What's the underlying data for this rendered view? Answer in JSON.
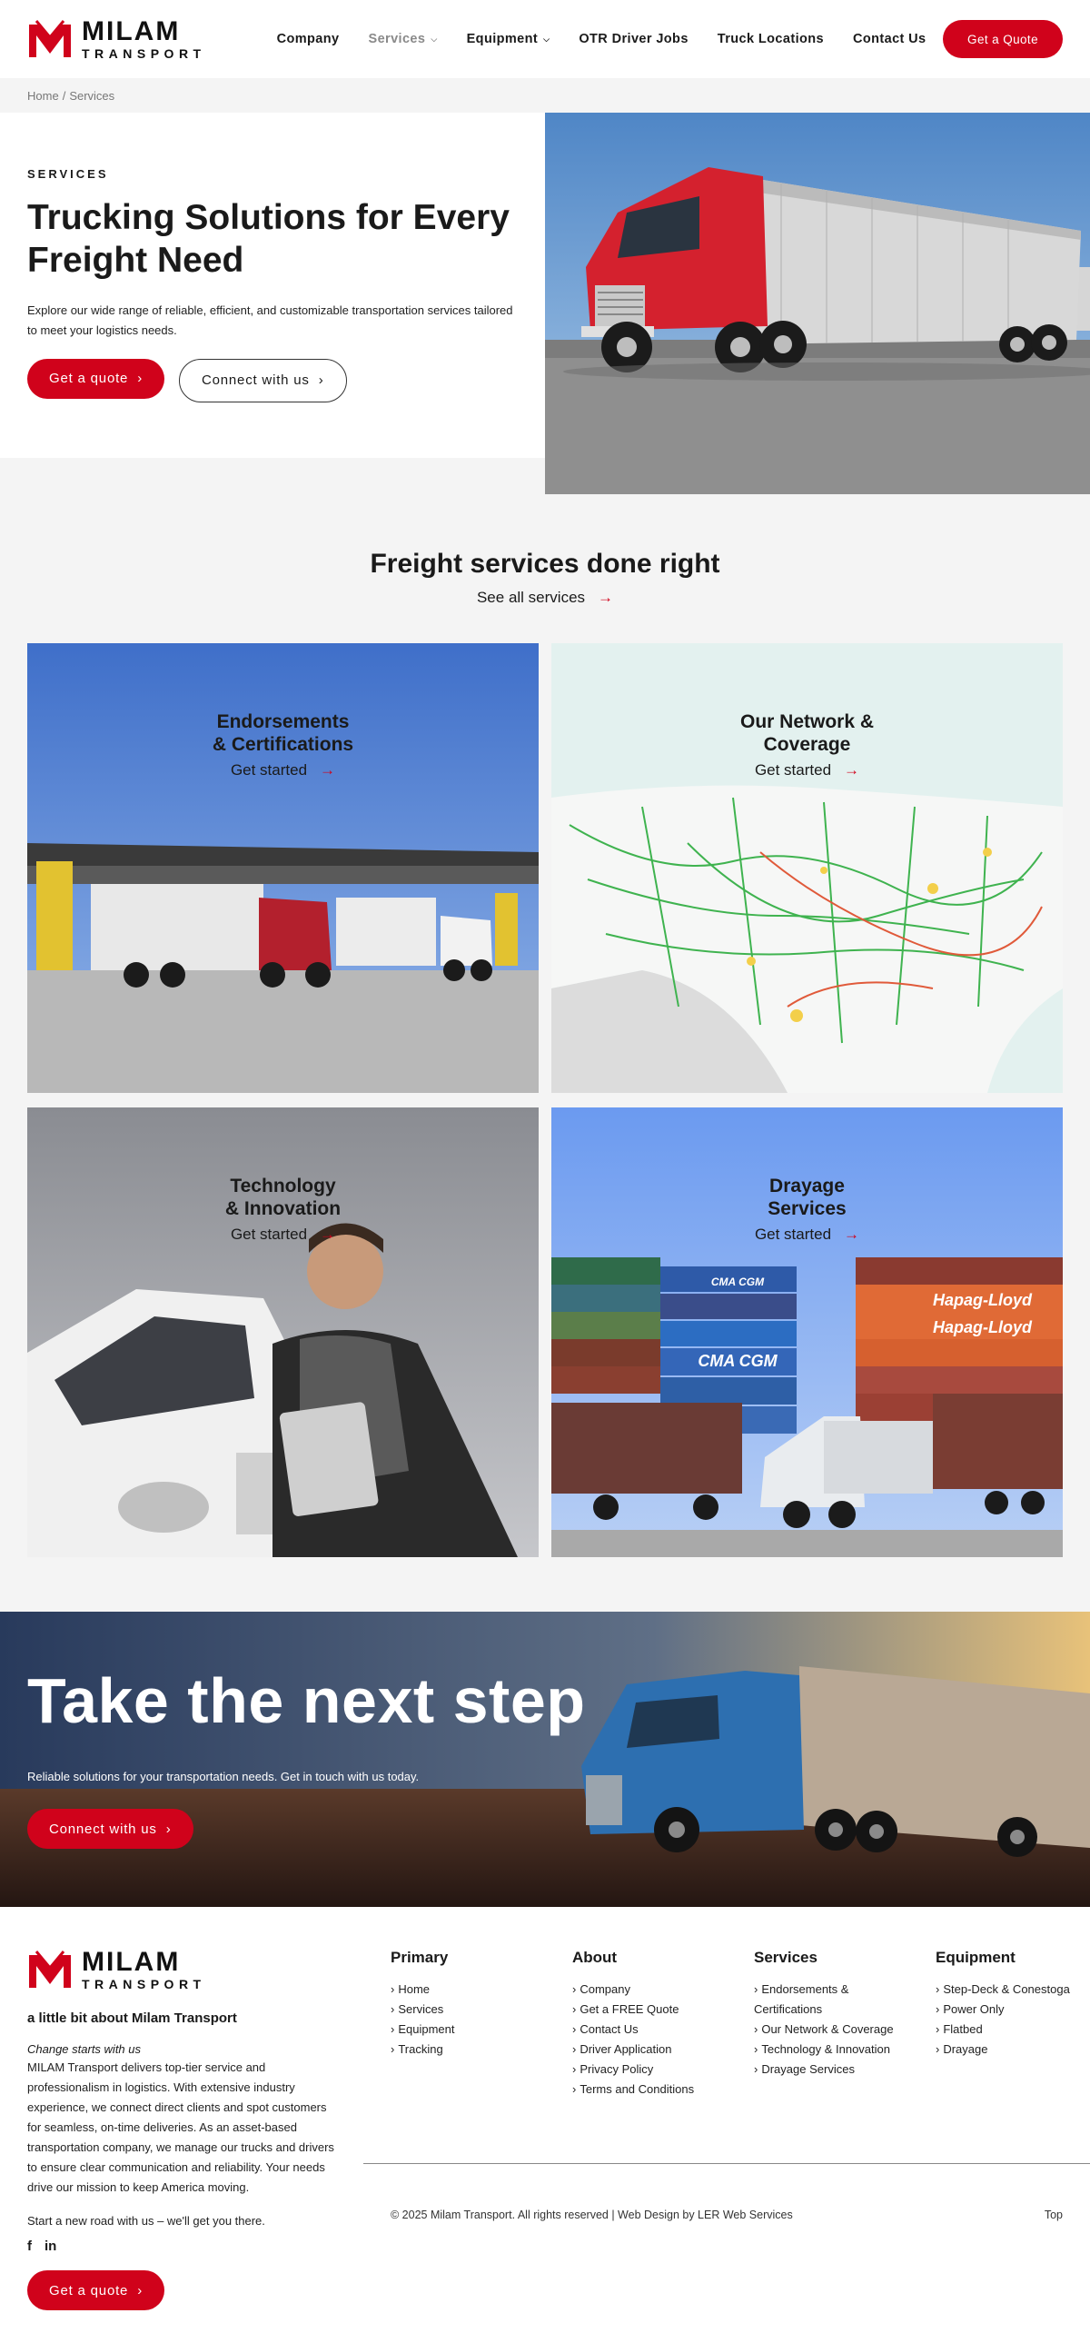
{
  "brand": {
    "name": "MILAM",
    "sub": "TRANSPORT",
    "red": "#d0021b"
  },
  "nav": {
    "items": [
      {
        "label": "Company",
        "caret": false,
        "active": false
      },
      {
        "label": "Services",
        "caret": true,
        "active": true
      },
      {
        "label": "Equipment",
        "caret": true,
        "active": false
      },
      {
        "label": "OTR Driver Jobs",
        "caret": false,
        "active": false
      },
      {
        "label": "Truck Locations",
        "caret": false,
        "active": false
      },
      {
        "label": "Contact Us",
        "caret": false,
        "active": false
      }
    ],
    "quote_button": "Get a Quote"
  },
  "breadcrumb": {
    "home": "Home",
    "separator": "/",
    "current": "Services"
  },
  "hero": {
    "eyebrow": "SERVICES",
    "title": "Trucking Solutions for Every Freight Need",
    "description": "Explore our wide range of reliable, efficient, and customizable transportation services tailored to meet your logistics needs.",
    "primary_button": "Get a quote",
    "secondary_button": "Connect with us",
    "chevron": "›"
  },
  "services": {
    "title": "Freight services done right",
    "see_all": "See all services",
    "arrow": "→",
    "cards": [
      {
        "title": "Endorsements\n& Certifications",
        "cta": "Get started"
      },
      {
        "title": "Our Network &\nCoverage",
        "cta": "Get started"
      },
      {
        "title": "Technology\n& Innovation",
        "cta": "Get started"
      },
      {
        "title": "Drayage\nServices",
        "cta": "Get started"
      }
    ],
    "container_labels": [
      "CMA CGM",
      "Hapag-Lloyd",
      "Hapag-Lloyd",
      "CMA CGM"
    ]
  },
  "cta": {
    "title": "Take the next step",
    "description": "Reliable solutions for your transportation needs. Get in touch with us today.",
    "button": "Connect with us"
  },
  "footer": {
    "tagline": "a little bit about Milam Transport",
    "italic": "Change starts with us",
    "about": "MILAM Transport delivers top-tier service and professionalism in logistics. With extensive industry experience, we connect direct clients and spot customers for seamless, on-time deliveries. As an asset-based transportation company, we manage our trucks and drivers to ensure clear communication and reliability. Your needs drive our mission to keep America moving.",
    "road": "Start a new road with us – we'll get you there.",
    "social": {
      "facebook": "f",
      "linkedin": "in"
    },
    "button": "Get a quote",
    "columns": [
      {
        "title": "Primary",
        "links": [
          "Home",
          "Services",
          "Equipment",
          "Tracking"
        ]
      },
      {
        "title": "About",
        "links": [
          "Company",
          "Get a FREE Quote",
          "Contact Us",
          "Driver Application",
          "Privacy Policy",
          "Terms and Conditions"
        ]
      },
      {
        "title": "Services",
        "links": [
          "Endorsements & Certifications",
          "Our Network & Coverage",
          "Technology & Innovation",
          "Drayage Services"
        ]
      },
      {
        "title": "Equipment",
        "links": [
          "Step-Deck & Conestoga",
          "Power Only",
          "Flatbed",
          "Drayage"
        ]
      }
    ],
    "copyright": "© 2025 Milam Transport. All rights reserved | Web Design by LER Web Services",
    "top": "Top"
  }
}
